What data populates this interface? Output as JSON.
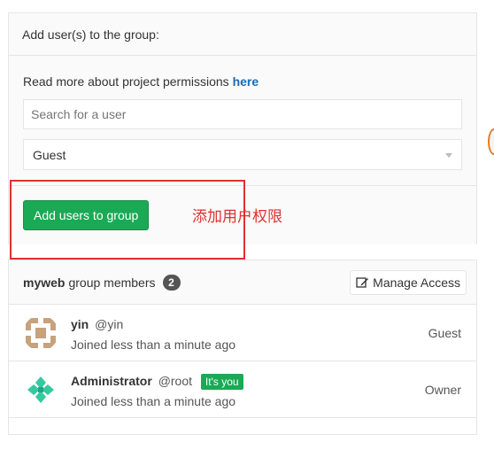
{
  "add_panel": {
    "title": "Add user(s) to the group:",
    "permissions_text": "Read more about project permissions ",
    "permissions_link": "here",
    "search_placeholder": "Search for a user",
    "access_level": "Guest",
    "add_button": "Add users to group"
  },
  "annotation": {
    "text": "添加用户权限",
    "color": "#e0312f"
  },
  "members": {
    "group_name": "myweb",
    "header_label": "group members",
    "count": "2",
    "manage_button": "Manage Access",
    "rows": [
      {
        "name": "yin",
        "username": "@yin",
        "joined": "Joined less than a minute ago",
        "role": "Guest",
        "badge": ""
      },
      {
        "name": "Administrator",
        "username": "@root",
        "joined": "Joined less than a minute ago",
        "role": "Owner",
        "badge": "It's you"
      }
    ]
  },
  "colors": {
    "accent_green": "#1aaa55",
    "link_blue": "#1b69b6"
  }
}
